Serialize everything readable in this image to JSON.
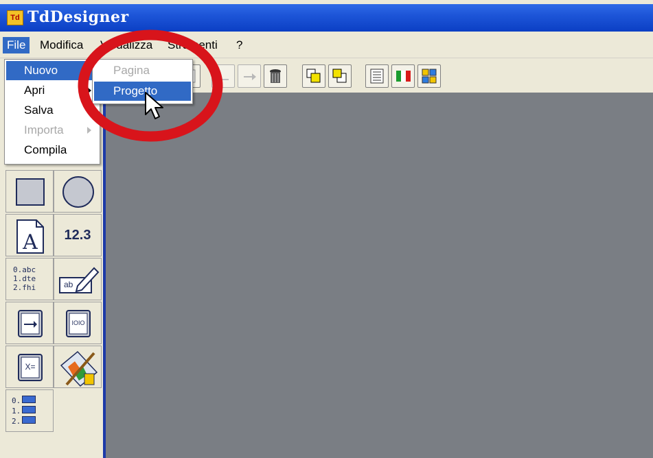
{
  "window": {
    "app_icon_text": "Td",
    "title": "TdDesigner"
  },
  "menubar": {
    "items": [
      {
        "label": "File"
      },
      {
        "label": "Modifica"
      },
      {
        "label": "Visualizza"
      },
      {
        "label": "Strumenti"
      },
      {
        "label": "?"
      }
    ]
  },
  "file_menu": {
    "items": [
      {
        "label": "Nuovo",
        "state": "highlighted",
        "has_submenu": true
      },
      {
        "label": "Apri",
        "state": "enabled",
        "has_submenu": true
      },
      {
        "label": "Salva",
        "state": "enabled"
      },
      {
        "label": "Importa",
        "state": "disabled",
        "has_submenu": true
      },
      {
        "label": "Compila",
        "state": "enabled"
      }
    ]
  },
  "nuovo_submenu": {
    "items": [
      {
        "label": "Pagina",
        "state": "disabled"
      },
      {
        "label": "Progetto",
        "state": "highlighted"
      }
    ]
  },
  "toolbar": {
    "buttons": [
      {
        "icon": "blank-icon"
      },
      {
        "icon": "undo-icon"
      },
      {
        "icon": "redo-icon"
      },
      {
        "icon": "trash-icon"
      },
      {
        "icon": "bring-front-icon"
      },
      {
        "icon": "send-back-icon"
      },
      {
        "icon": "grid-icon"
      },
      {
        "icon": "language-flag-icon"
      },
      {
        "icon": "color-palette-icon"
      }
    ]
  },
  "palette": {
    "tools": [
      {
        "name": "rectangle-tool",
        "icon": "square-icon"
      },
      {
        "name": "ellipse-tool",
        "icon": "circle-icon"
      },
      {
        "name": "text-tool",
        "icon": "letter-a-icon"
      },
      {
        "name": "number-tool",
        "label": "12.3"
      },
      {
        "name": "list-tool",
        "lines": [
          "0.abc",
          "1.dte",
          "2.fhi"
        ]
      },
      {
        "name": "edit-field-tool",
        "label": "ab"
      },
      {
        "name": "button-tool",
        "icon": "arrow-button-icon"
      },
      {
        "name": "binary-tool",
        "label": "IOIO"
      },
      {
        "name": "formula-tool",
        "label": "X="
      },
      {
        "name": "image-tool",
        "icon": "paint-brush-icon"
      },
      {
        "name": "image-list-tool",
        "lines": [
          "0.",
          "1.",
          "2."
        ]
      }
    ]
  },
  "colors": {
    "title_bar": "#0b3fc4",
    "menu_highlight": "#316ac5",
    "canvas": "#7a7e84",
    "annotation_circle": "#d8141b"
  }
}
